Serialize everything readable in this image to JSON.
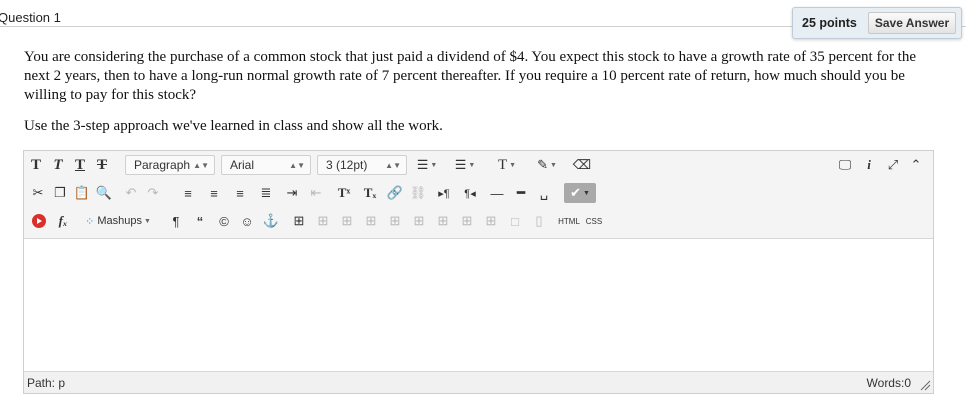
{
  "question": {
    "title": "Question 1",
    "points": "25 points",
    "save_label": "Save Answer",
    "body": "You are considering the purchase of a common stock that just paid a dividend of $4. You expect this stock to have a growth rate of 35 percent for the next 2 years, then to have a long-run normal growth rate of 7 percent thereafter. If you require a 10 percent rate of return, how much should you be willing to pay for this stock?",
    "instruction": "Use the 3-step approach we've learned in class and show all the work."
  },
  "editor": {
    "format_value": "Paragraph",
    "font_value": "Arial",
    "size_value": "3 (12pt)",
    "mashups_label": "Mashups",
    "html_label": "HTML",
    "css_label": "CSS",
    "path_label": "Path: p",
    "words_label": "Words:0",
    "content": ""
  },
  "colors": {
    "points_bg": "#e7eef4",
    "toolbar_bg": "#f4f4f4",
    "youtube_red": "#d9302c"
  }
}
